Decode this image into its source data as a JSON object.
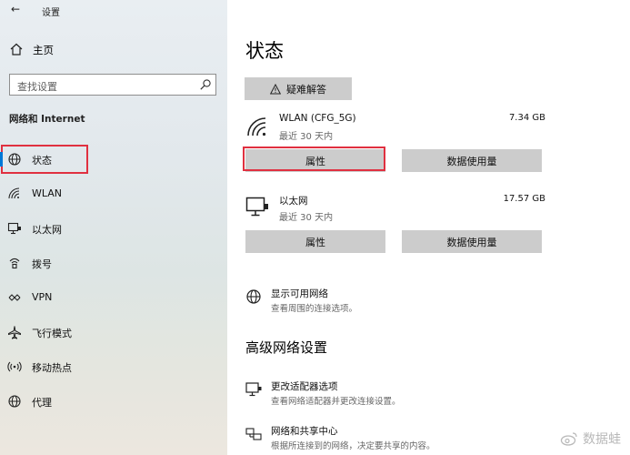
{
  "window": {
    "title": "设置"
  },
  "sidebar": {
    "home_label": "主页",
    "search_placeholder": "查找设置",
    "section_label": "网络和 Internet",
    "items": [
      {
        "label": "状态",
        "icon": "globe-icon",
        "selected": true
      },
      {
        "label": "WLAN",
        "icon": "wifi-icon",
        "selected": false
      },
      {
        "label": "以太网",
        "icon": "ethernet-icon",
        "selected": false
      },
      {
        "label": "拨号",
        "icon": "dialup-icon",
        "selected": false
      },
      {
        "label": "VPN",
        "icon": "vpn-icon",
        "selected": false
      },
      {
        "label": "飞行模式",
        "icon": "airplane-icon",
        "selected": false
      },
      {
        "label": "移动热点",
        "icon": "hotspot-icon",
        "selected": false
      },
      {
        "label": "代理",
        "icon": "proxy-globe-icon",
        "selected": false
      }
    ]
  },
  "main": {
    "title": "状态",
    "troubleshoot_label": "疑难解答",
    "networks": [
      {
        "name": "WLAN (CFG_5G)",
        "period": "最近 30 天内",
        "size": "7.34 GB",
        "icon": "wifi-signal-icon",
        "properties_label": "属性",
        "usage_label": "数据使用量"
      },
      {
        "name": "以太网",
        "period": "最近 30 天内",
        "size": "17.57 GB",
        "icon": "ethernet-monitor-icon",
        "properties_label": "属性",
        "usage_label": "数据使用量"
      }
    ],
    "show_networks": {
      "title": "显示可用网络",
      "desc": "查看周围的连接选项。"
    },
    "advanced_title": "高级网络设置",
    "adapter_options": {
      "title": "更改适配器选项",
      "desc": "查看网络适配器并更改连接设置。"
    },
    "sharing_center": {
      "title": "网络和共享中心",
      "desc": "根据所连接到的网络，决定要共享的内容。"
    }
  },
  "watermark": {
    "text": "数据蛙"
  },
  "colors": {
    "highlight": "#e03040",
    "button_bg": "#cccccc",
    "accent": "#0078d7"
  }
}
